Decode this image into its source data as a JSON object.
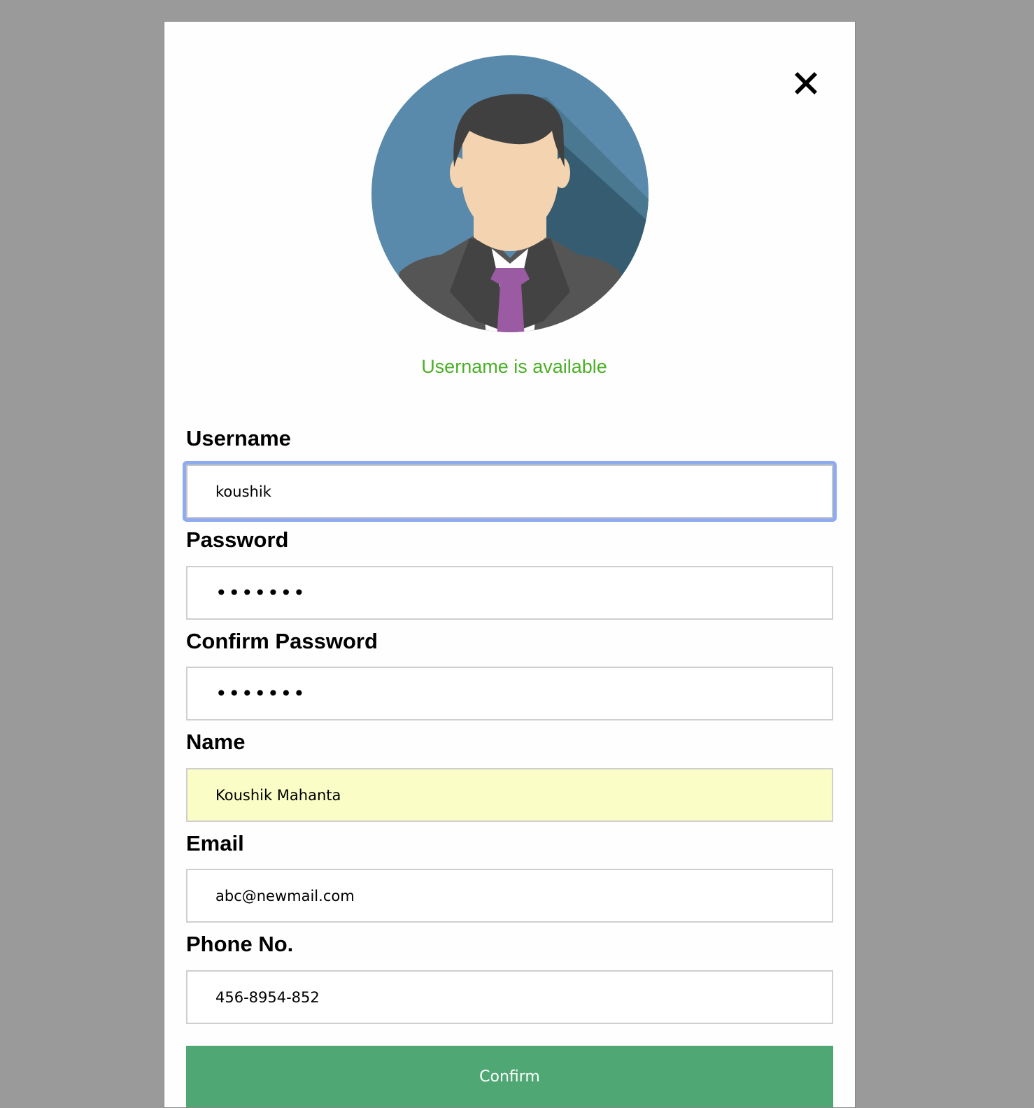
{
  "modal": {
    "close_icon": "close-icon",
    "avatar_icon": "user-avatar-icon",
    "status_message": "Username is available",
    "status_color": "#4caf28"
  },
  "form": {
    "username": {
      "label": "Username",
      "value": "koushik"
    },
    "password": {
      "label": "Password",
      "value": "•••••••"
    },
    "confirm_password": {
      "label": "Confirm Password",
      "value": "•••••••"
    },
    "name": {
      "label": "Name",
      "value": "Koushik Mahanta"
    },
    "email": {
      "label": "Email",
      "value": "abc@newmail.com"
    },
    "phone": {
      "label": "Phone No.",
      "value": "456-8954-852"
    },
    "confirm_label": "Confirm",
    "confirm_color": "#4fa874"
  }
}
